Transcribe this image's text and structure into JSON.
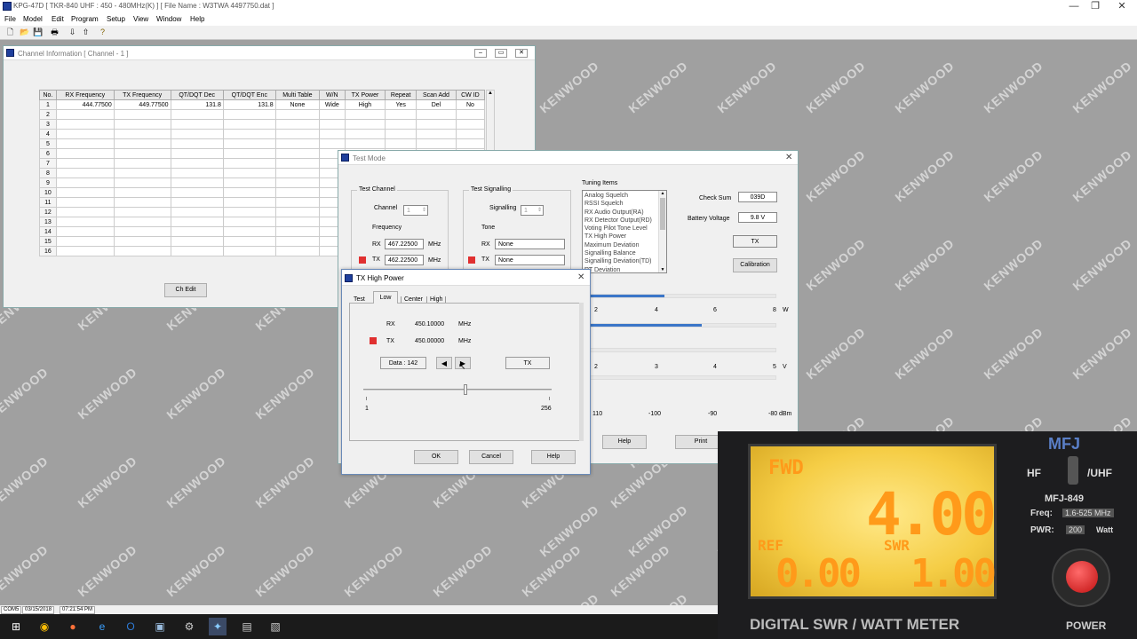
{
  "app": {
    "title": "KPG-47D  [ TKR-840 UHF : 450 - 480MHz(K) ] [ File Name : W3TWA 4497750.dat ]"
  },
  "menu": [
    "File",
    "Model",
    "Edit",
    "Program",
    "Setup",
    "View",
    "Window",
    "Help"
  ],
  "watermark": "KENWOOD",
  "channel_window": {
    "title": "Channel Information [ Channel - 1 ]",
    "columns": [
      "No.",
      "RX Frequency",
      "TX Frequency",
      "QT/DQT Dec",
      "QT/DQT Enc",
      "Multi Table",
      "W/N",
      "TX Power",
      "Repeat",
      "Scan Add",
      "CW ID"
    ],
    "row1": [
      "1",
      "444.77500",
      "449.77500",
      "131.8",
      "131.8",
      "None",
      "Wide",
      "High",
      "Yes",
      "Del",
      "No"
    ],
    "row_numbers": [
      "2",
      "3",
      "4",
      "5",
      "6",
      "7",
      "8",
      "9",
      "10",
      "11",
      "12",
      "13",
      "14",
      "15",
      "16"
    ],
    "ch_edit": "Ch Edit"
  },
  "test_mode": {
    "title": "Test Mode",
    "test_channel": "Test Channel",
    "channel_label": "Channel",
    "channel_value": "1",
    "frequency_label": "Frequency",
    "rx_label": "RX",
    "rx_freq": "467.22500",
    "tx_label": "TX",
    "tx_freq": "462.22500",
    "mhz": "MHz",
    "test_signalling": "Test Signalling",
    "signalling_label": "Signalling",
    "signalling_value": "1",
    "tone_label": "Tone",
    "rx_tone": "None",
    "tx_tone": "None",
    "tuning_items_label": "Tuning Items",
    "tuning_items": [
      "Analog Squelch",
      "RSSI Squelch",
      "RX Audio Output(RA)",
      "RX Detector Output(RD)",
      "Voting Pilot Tone Level",
      "TX High Power",
      "Maximum Deviation",
      "Signalling Balance",
      "Signalling Deviation(TD)",
      "RT Deviation"
    ],
    "checksum_label": "Check Sum",
    "checksum": "039D",
    "battery_label": "Battery Voltage",
    "battery": "9.8 V",
    "tx_button": "TX",
    "calibration": "Calibration",
    "power_ticks": [
      "2",
      "4",
      "6",
      "8"
    ],
    "power_unit": "W",
    "power_level": 0.4,
    "volt_ticks": [
      "2",
      "3",
      "4",
      "5"
    ],
    "volt_unit": "V",
    "volt_level": 0.6,
    "dbm_ticks": [
      "110",
      "-100",
      "-90",
      "-80"
    ],
    "dbm_unit": "dBm",
    "help": "Help",
    "print": "Print"
  },
  "tx_high_power": {
    "title": "TX High Power",
    "tabs": [
      "Test",
      "Low",
      "Center",
      "High"
    ],
    "rx_label": "RX",
    "rx_freq": "450.10000",
    "tx_label": "TX",
    "tx_freq": "450.00000",
    "mhz": "MHz",
    "data": "Data : 142",
    "tx_button": "TX",
    "slider_min": "1",
    "slider_max": "256",
    "slider_value": 142,
    "ok": "OK",
    "cancel": "Cancel",
    "help": "Help"
  },
  "statusbar": {
    "port": "COM5",
    "date": "03/15/2018",
    "time": "07:21:54 PM"
  },
  "meter": {
    "fwd_label": "FWD",
    "fwd_value": "4.00",
    "ref_label": "REF",
    "ref_value": "0.00",
    "swr_label": "SWR",
    "swr_value": "1.00",
    "brand": "MFJ",
    "model": "MFJ-849",
    "hf": "HF",
    "uhf": "/UHF",
    "freq_label": "Freq:",
    "freq_value": "1.6-525 MHz",
    "pwr_label": "PWR:",
    "pwr_value": "200",
    "pwr_unit": "Watt",
    "caption": "DIGITAL SWR / WATT METER",
    "power": "POWER"
  }
}
